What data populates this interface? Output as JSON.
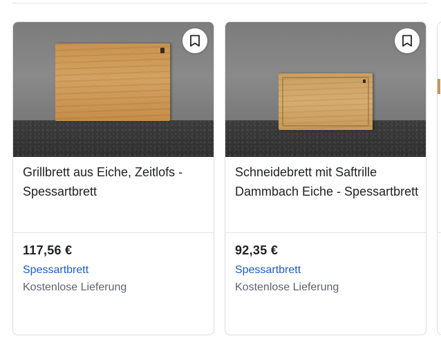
{
  "products": [
    {
      "title": "Grillbrett aus Eiche, Zeitlofs - Spessartbrett",
      "price": "117,56 €",
      "seller": "Spessartbrett",
      "delivery": "Kostenlose Lieferung",
      "image_alt": "oak-cutting-board-plain"
    },
    {
      "title": "Schneidebrett mit Saftrille Dammbach Eiche - Spessartbrett",
      "price": "92,35 €",
      "seller": "Spessartbrett",
      "delivery": "Kostenlose Lieferung",
      "image_alt": "oak-cutting-board-juice-groove"
    }
  ],
  "icons": {
    "bookmark": "bookmark-icon"
  },
  "colors": {
    "seller_link": "#1a5dc8",
    "secondary_text": "#5f6368",
    "border": "#dadce0"
  }
}
